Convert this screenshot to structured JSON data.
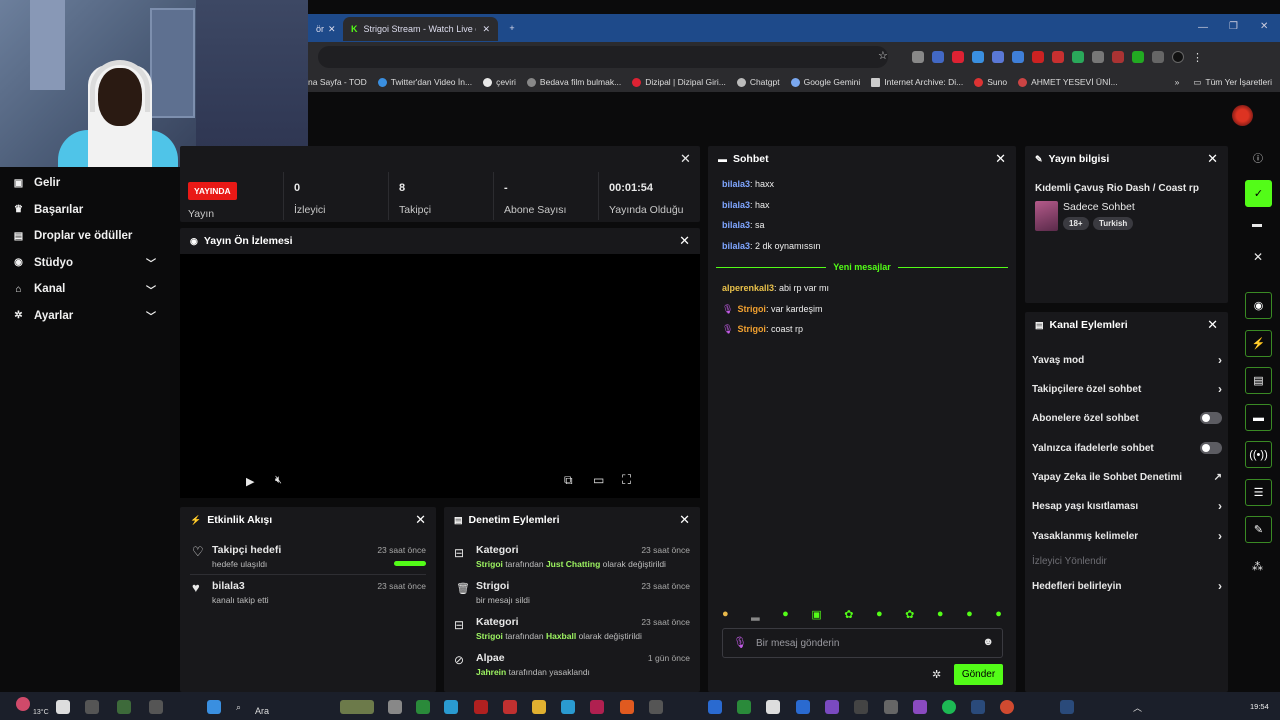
{
  "browser": {
    "tabs": [
      {
        "label": "ör"
      },
      {
        "label": "Strigoi Stream - Watch Live on"
      }
    ],
    "bookmarks": [
      "na Sayfa - TOD",
      "Twitter'dan Video İn...",
      "çeviri",
      "Bedava film bulmak...",
      "Dizipal | Dizipal Giri...",
      "Chatgpt",
      "Google Gemini",
      "Internet Archive: Di...",
      "Suno",
      "AHMET YESEVİ ÜNİ..."
    ],
    "all_bookmarks": "Tüm Yer İşaretleri"
  },
  "sidebar": {
    "items": [
      {
        "label": "Gelir",
        "icon": "receipt-icon"
      },
      {
        "label": "Başarılar",
        "icon": "trophy-icon"
      },
      {
        "label": "Droplar ve ödüller",
        "icon": "gift-icon"
      },
      {
        "label": "Stüdyo",
        "icon": "broadcast-icon"
      },
      {
        "label": "Kanal",
        "icon": "channel-icon"
      },
      {
        "label": "Ayarlar",
        "icon": "gear-icon"
      }
    ]
  },
  "stats": {
    "live_badge": "YAYINDA",
    "live_label": "Yayın",
    "viewers": "0",
    "viewers_label": "İzleyici",
    "followers": "8",
    "followers_label": "Takipçi",
    "subs": "-",
    "subs_label": "Abone Sayısı",
    "uptime": "00:01:54",
    "uptime_label": "Yayında Olduğu"
  },
  "preview": {
    "title": "Yayın Ön İzlemesi"
  },
  "activity": {
    "title": "Etkinlik Akışı",
    "items": [
      {
        "title": "Takipçi hedefi",
        "sub": "hedefe ulaşıldı",
        "time": "23 saat önce",
        "progress": 1.0
      },
      {
        "title": "bilala3",
        "sub": "kanalı takip etti",
        "time": "23 saat önce"
      }
    ]
  },
  "moderation": {
    "title": "Denetim Eylemleri",
    "items": [
      {
        "title": "Kategori",
        "time": "23 saat önce",
        "user": "Strigoi",
        "mid": "tarafından",
        "target": "Just Chatting",
        "end": "olarak değiştirildi"
      },
      {
        "title": "Strigoi",
        "time": "23 saat önce",
        "sub": "bir mesajı sildi"
      },
      {
        "title": "Kategori",
        "time": "23 saat önce",
        "user": "Strigoi",
        "mid": "tarafından",
        "target": "Haxball",
        "end": "olarak değiştirildi"
      },
      {
        "title": "Alpae",
        "time": "1 gün önce",
        "user": "Jahrein",
        "end": "tarafından yasaklandı"
      }
    ]
  },
  "chat": {
    "title": "Sohbet",
    "messages": [
      {
        "user": "bilala3",
        "text": ": haxx"
      },
      {
        "user": "bilala3",
        "text": ": hax"
      },
      {
        "user": "bilala3",
        "text": ": sa"
      },
      {
        "user": "bilala3",
        "text": ": 2 dk oynamıssın"
      }
    ],
    "divider": "Yeni mesajlar",
    "new_messages": [
      {
        "user": "alperenkall3",
        "text": ": abi rp var mı"
      },
      {
        "user": "Strigoi",
        "text": ": var kardeşim"
      },
      {
        "user": "Strigoi",
        "text": ": coast rp"
      }
    ],
    "placeholder": "Bir mesaj gönderin",
    "send": "Gönder"
  },
  "stream_info": {
    "title": "Yayın bilgisi",
    "stream_title": "Kıdemli Çavuş Rio Dash / Coast rp",
    "category": "Sadece Sohbet",
    "tags": [
      "18+",
      "Turkish"
    ]
  },
  "channel_actions": {
    "title": "Kanal Eylemleri",
    "items": [
      {
        "label": "Yavaş mod",
        "kind": "arrow"
      },
      {
        "label": "Takipçilere özel sohbet",
        "kind": "arrow"
      },
      {
        "label": "Abonelere özel sohbet",
        "kind": "toggle"
      },
      {
        "label": "Yalnızca ifadelerle sohbet",
        "kind": "toggle"
      },
      {
        "label": "Yapay Zeka ile Sohbet Denetimi",
        "kind": "external"
      },
      {
        "label": "Hesap yaşı kısıtlaması",
        "kind": "arrow"
      },
      {
        "label": "Yasaklanmış kelimeler",
        "kind": "arrow"
      }
    ],
    "section": "İzleyici Yönlendir",
    "goals": "Hedefleri belirleyin"
  },
  "taskbar": {
    "temp": "13°C",
    "search": "Ara",
    "time": "19:54"
  },
  "colors": {
    "accent": "#53fc18",
    "live": "#e91916",
    "chat_user": "#7fa6ff"
  }
}
